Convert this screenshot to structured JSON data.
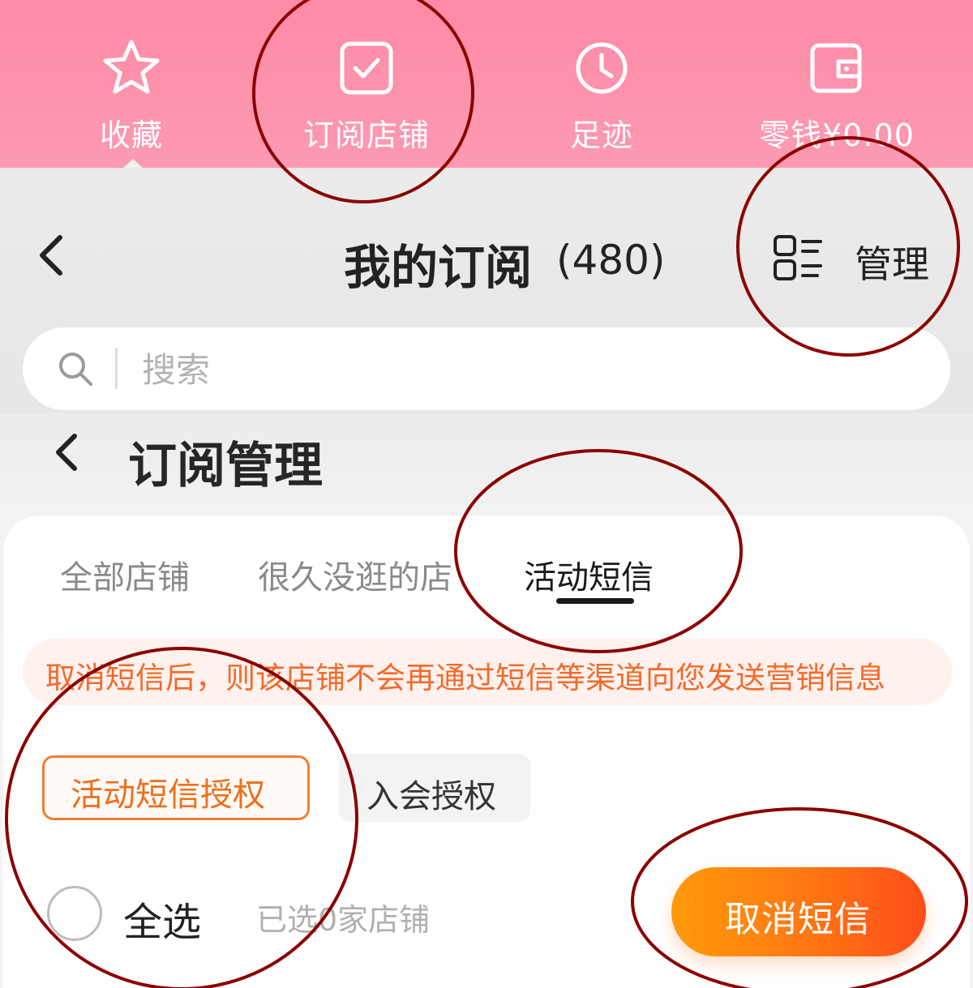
{
  "top_nav": {
    "items": [
      {
        "label": "收藏",
        "icon": "star-icon"
      },
      {
        "label": "订阅店铺",
        "icon": "checkbox-icon"
      },
      {
        "label": "足迹",
        "icon": "clock-icon"
      },
      {
        "label": "零钱¥0.00",
        "icon": "wallet-icon"
      }
    ]
  },
  "header": {
    "title": "我的订阅",
    "count": "(480)",
    "manage_label": "管理",
    "back_icon": "chevron-left-icon",
    "manage_icon": "manage-list-icon"
  },
  "search": {
    "placeholder": "搜索",
    "value": "",
    "icon": "search-icon"
  },
  "sub_header": {
    "title": "订阅管理",
    "back_icon": "chevron-left-icon"
  },
  "tabs": [
    {
      "label": "全部店铺",
      "active": false
    },
    {
      "label": "很久没逛的店",
      "active": false
    },
    {
      "label": "活动短信",
      "active": true
    }
  ],
  "notice": {
    "text": "取消短信后，则该店铺不会再通过短信等渠道向您发送营销信息"
  },
  "chips": [
    {
      "label": "活动短信授权",
      "selected": true
    },
    {
      "label": "入会授权",
      "selected": false
    }
  ],
  "footer": {
    "select_all_label": "全选",
    "selected_info": "已选0家店铺",
    "cancel_button_label": "取消短信"
  },
  "colors": {
    "nav_pink": "#fd8aa6",
    "accent_orange": "#f07e33",
    "notice_text": "#f26b2c",
    "annotation_red": "#8b0000"
  }
}
